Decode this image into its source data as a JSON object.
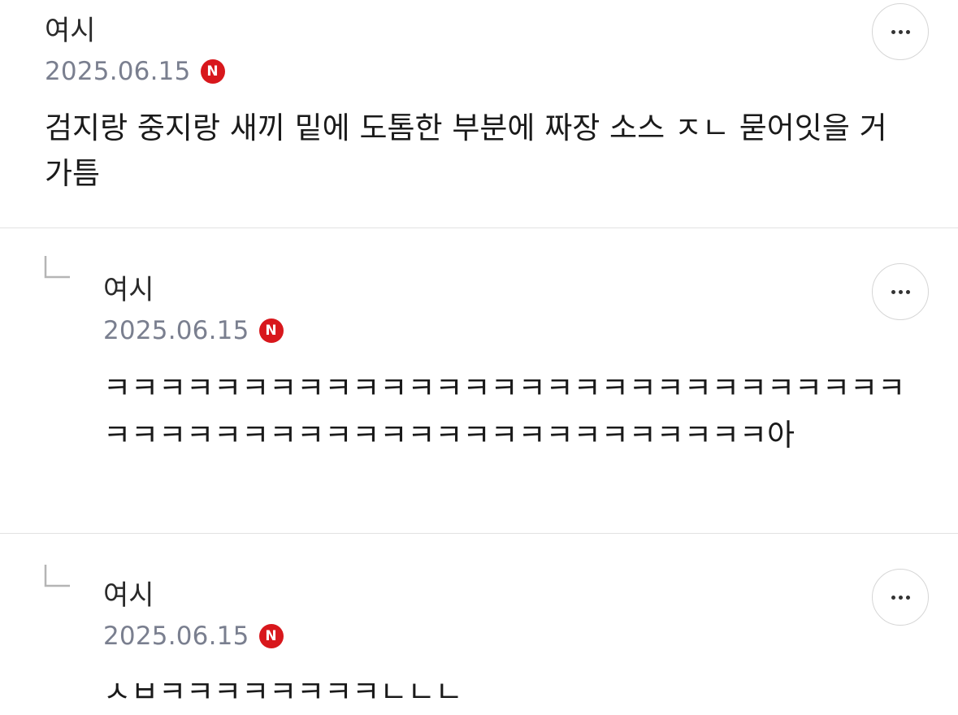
{
  "comments": [
    {
      "author": "여시",
      "date": "2025.06.15",
      "badge": "N",
      "text": "검지랑 중지랑 새끼 밑에 도톰한 부분에 짜장 소스 ㅈㄴ 묻어잇을 거 가틈"
    },
    {
      "author": "여시",
      "date": "2025.06.15",
      "badge": "N",
      "text": "ㅋㅋㅋㅋㅋㅋㅋㅋㅋㅋㅋㅋㅋㅋㅋㅋㅋㅋㅋㅋㅋㅋㅋㅋㅋㅋㅋㅋㅋㅋㅋㅋㅋㅋㅋㅋㅋㅋㅋㅋㅋㅋㅋㅋㅋㅋㅋㅋㅋㅋㅋㅋㅋ아"
    },
    {
      "author": "여시",
      "date": "2025.06.15",
      "badge": "N",
      "text": "ㅅㅂㅋㅋㅋㅋㅋㅋㅋㅋㄴㄴㄴ"
    }
  ],
  "icons": {
    "more": "more-horizontal-icon",
    "reply": "reply-arrow-icon"
  },
  "colors": {
    "badge": "#d8171c",
    "date": "#7a7f8f",
    "divider": "#e2e2e2"
  }
}
